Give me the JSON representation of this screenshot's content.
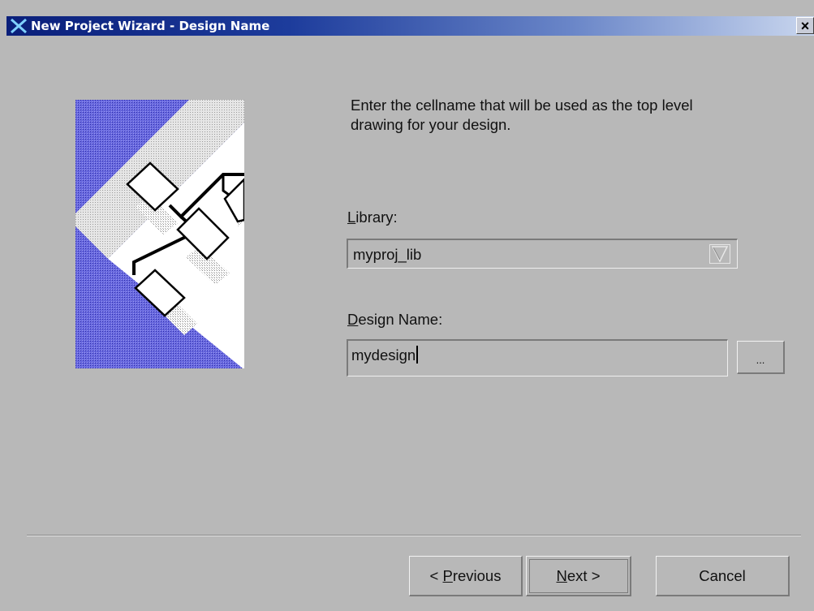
{
  "window": {
    "title": "New Project Wizard - Design Name",
    "close_glyph": "×"
  },
  "instructions": "Enter the cellname that will be used as the top level drawing for your design.",
  "library": {
    "label_mnemonic": "L",
    "label_rest": "ibrary:",
    "value": "myproj_lib",
    "arrow_icon": "dropdown-arrow-icon"
  },
  "design_name": {
    "label_mnemonic": "D",
    "label_rest": "esign Name:",
    "value": "mydesign",
    "browse_label": "..."
  },
  "buttons": {
    "previous_prefix": "< ",
    "previous_mnemonic": "P",
    "previous_rest": "revious",
    "next_mnemonic": "N",
    "next_rest": "ext >",
    "cancel": "Cancel"
  },
  "colors": {
    "titlebar_start": "#0a1f7a",
    "titlebar_end": "#c9d6ee",
    "dialog_bg": "#b8b8b8",
    "illustration_blue": "#5a5ad8"
  }
}
